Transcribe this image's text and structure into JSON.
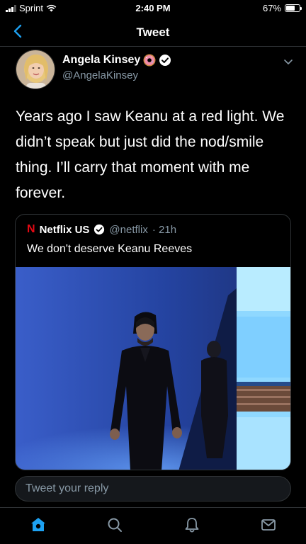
{
  "status_bar": {
    "carrier": "Sprint",
    "time": "2:40 PM",
    "battery": "67%",
    "battery_level": 0.67
  },
  "header": {
    "title": "Tweet"
  },
  "tweet": {
    "display_name": "Angela Kinsey",
    "handle": "@AngelaKinsey",
    "text": "Years ago I saw Keanu at a red light. We didn’t speak but just did the nod/smile thing. I’ll carry that moment with me forever."
  },
  "quoted_tweet": {
    "logo_letter": "N",
    "display_name": "Netflix US",
    "handle": "@netflix",
    "time": "· 21h",
    "text": "We don't deserve Keanu Reeves"
  },
  "reply": {
    "placeholder": "Tweet your reply"
  },
  "tab_bar": {
    "items": [
      {
        "icon": "home-icon",
        "active": true
      },
      {
        "icon": "search-icon",
        "active": false
      },
      {
        "icon": "notifications-icon",
        "active": false
      },
      {
        "icon": "messages-icon",
        "active": false
      }
    ]
  },
  "colors": {
    "accent": "#1da1f2",
    "background": "#000000",
    "secondary_text": "#8899a6",
    "border": "#2f3336",
    "netflix_red": "#e50914"
  }
}
